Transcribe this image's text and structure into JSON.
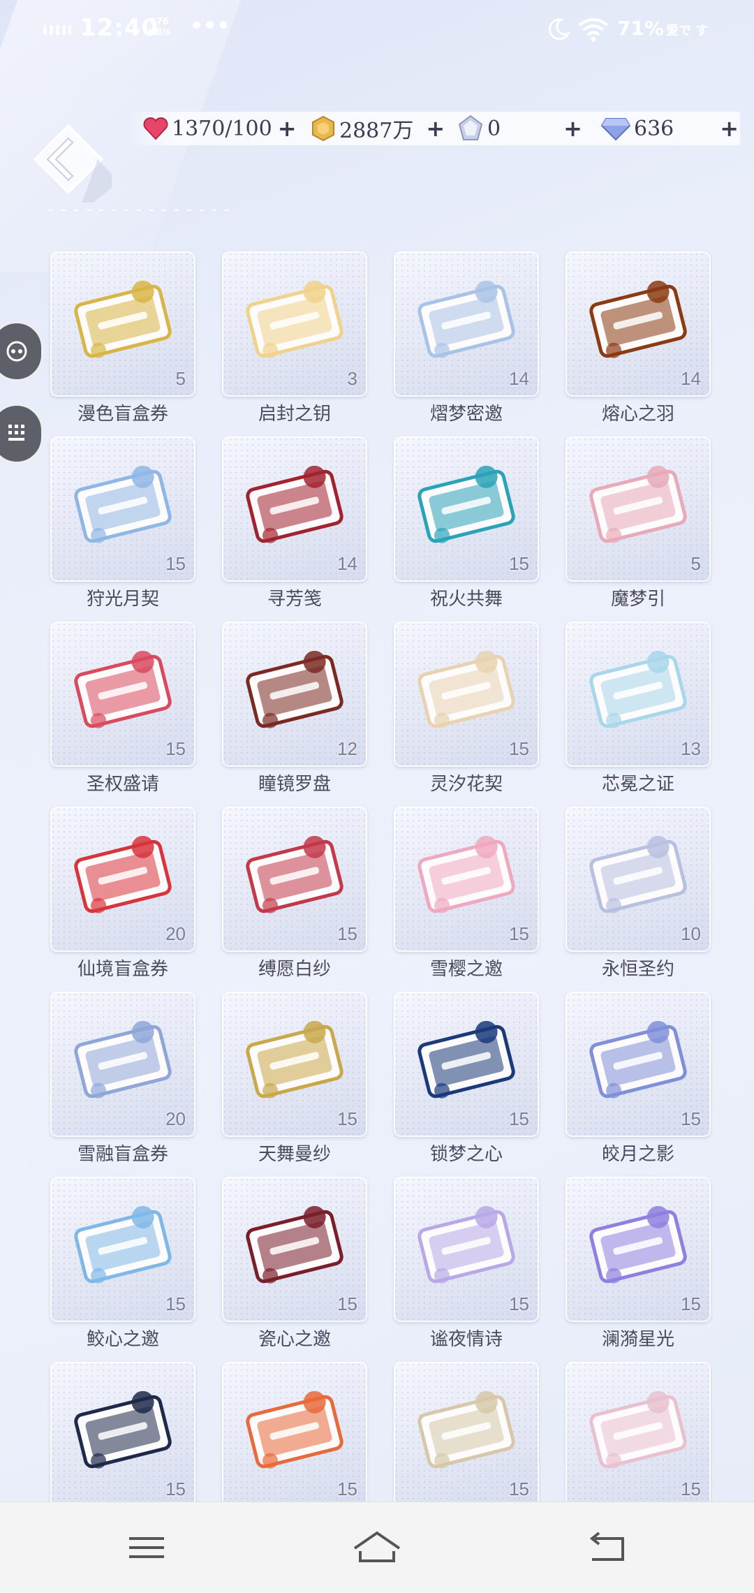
{
  "status_bar": {
    "time": "12:40",
    "net_speed_value": "476",
    "net_speed_unit": "KB/s",
    "more": "•••",
    "battery": "71%",
    "carrier": "爱で す"
  },
  "currencies": [
    {
      "icon": "heart-icon",
      "value": "1370/100",
      "plus": "+"
    },
    {
      "icon": "gold-coin-icon",
      "value": "2887万",
      "plus": "+"
    },
    {
      "icon": "crystal-icon",
      "value": "0",
      "plus": "+"
    },
    {
      "icon": "diamond-icon",
      "value": "636",
      "plus": "+"
    }
  ],
  "items": [
    {
      "name": "漫色盲盒券",
      "count": "5",
      "color": "#d9b547"
    },
    {
      "name": "启封之钥",
      "count": "3",
      "color": "#f0d28a"
    },
    {
      "name": "熠梦密邀",
      "count": "14",
      "color": "#a9c3e8"
    },
    {
      "name": "熔心之羽",
      "count": "14",
      "color": "#8a3b12"
    },
    {
      "name": "狩光月契",
      "count": "15",
      "color": "#8fb7e6"
    },
    {
      "name": "寻芳笺",
      "count": "14",
      "color": "#a22330"
    },
    {
      "name": "祝火共舞",
      "count": "15",
      "color": "#2aa3b8"
    },
    {
      "name": "魔梦引",
      "count": "5",
      "color": "#e8a9b8"
    },
    {
      "name": "圣权盛请",
      "count": "15",
      "color": "#d94a5e"
    },
    {
      "name": "瞳镜罗盘",
      "count": "12",
      "color": "#7a2a22"
    },
    {
      "name": "灵汐花契",
      "count": "15",
      "color": "#e8d2b0"
    },
    {
      "name": "芯冕之证",
      "count": "13",
      "color": "#a8d6ea"
    },
    {
      "name": "仙境盲盒券",
      "count": "20",
      "color": "#d8343c"
    },
    {
      "name": "缚愿白纱",
      "count": "15",
      "color": "#c23a4a"
    },
    {
      "name": "雪樱之邀",
      "count": "15",
      "color": "#f0a8c0"
    },
    {
      "name": "永恒圣约",
      "count": "10",
      "color": "#b8c0e0"
    },
    {
      "name": "雪融盲盒券",
      "count": "20",
      "color": "#8ea6d8"
    },
    {
      "name": "天舞曼纱",
      "count": "15",
      "color": "#c8a84a"
    },
    {
      "name": "锁梦之心",
      "count": "15",
      "color": "#1a3a7a"
    },
    {
      "name": "皎月之影",
      "count": "15",
      "color": "#7f8fd8"
    },
    {
      "name": "鲛心之邀",
      "count": "15",
      "color": "#7fb8e8"
    },
    {
      "name": "瓷心之邀",
      "count": "15",
      "color": "#7a1e2a"
    },
    {
      "name": "谧夜情诗",
      "count": "15",
      "color": "#b8a8e8"
    },
    {
      "name": "澜漪星光",
      "count": "15",
      "color": "#8e7fe0"
    },
    {
      "name": "",
      "count": "15",
      "color": "#1f2a4a"
    },
    {
      "name": "",
      "count": "15",
      "color": "#e86a3a"
    },
    {
      "name": "",
      "count": "15",
      "color": "#d6c8a8"
    },
    {
      "name": "",
      "count": "15",
      "color": "#e8c0d0"
    }
  ]
}
